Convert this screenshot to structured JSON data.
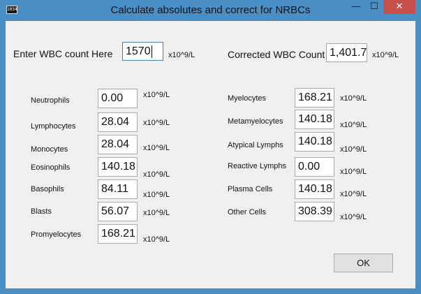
{
  "window": {
    "title": "Calculate absolutes and correct for NRBCs",
    "minimize_glyph": "—",
    "maximize_glyph": "☐",
    "close_glyph": "✕",
    "app_icon_text": "1034"
  },
  "wbc": {
    "label": "Enter WBC count Here",
    "value": "1570",
    "unit": "x10^9/L"
  },
  "corrected": {
    "label": "Corrected WBC Count",
    "value": "1,401.7",
    "unit": "x10^9/L"
  },
  "left_cells": [
    {
      "label": "Neutrophils",
      "value": "0.00",
      "unit": "x10^9/L"
    },
    {
      "label": "Lymphocytes",
      "value": "28.04",
      "unit": "x10^9/L"
    },
    {
      "label": "Monocytes",
      "value": "28.04",
      "unit": "x10^9/L"
    },
    {
      "label": "Eosinophils",
      "value": "140.18",
      "unit": "x10^9/L"
    },
    {
      "label": "Basophils",
      "value": "84.11",
      "unit": "x10^9/L"
    },
    {
      "label": "Blasts",
      "value": "56.07",
      "unit": "x10^9/L"
    },
    {
      "label": "Promyelocytes",
      "value": "168.21",
      "unit": "x10^9/L"
    }
  ],
  "right_cells": [
    {
      "label": "Myelocytes",
      "value": "168.21",
      "unit": "x10^9/L"
    },
    {
      "label": "Metamyelocytes",
      "value": "140.18",
      "unit": "x10^9/L"
    },
    {
      "label": "Atypical Lymphs",
      "value": "140.18",
      "unit": "x10^9/L"
    },
    {
      "label": "Reactive Lymphs",
      "value": "0.00",
      "unit": "x10^9/L"
    },
    {
      "label": "Plasma Cells",
      "value": "140.18",
      "unit": "x10^9/L"
    },
    {
      "label": "Other Cells",
      "value": "308.39",
      "unit": "x10^9/L"
    }
  ],
  "ok_label": "OK"
}
